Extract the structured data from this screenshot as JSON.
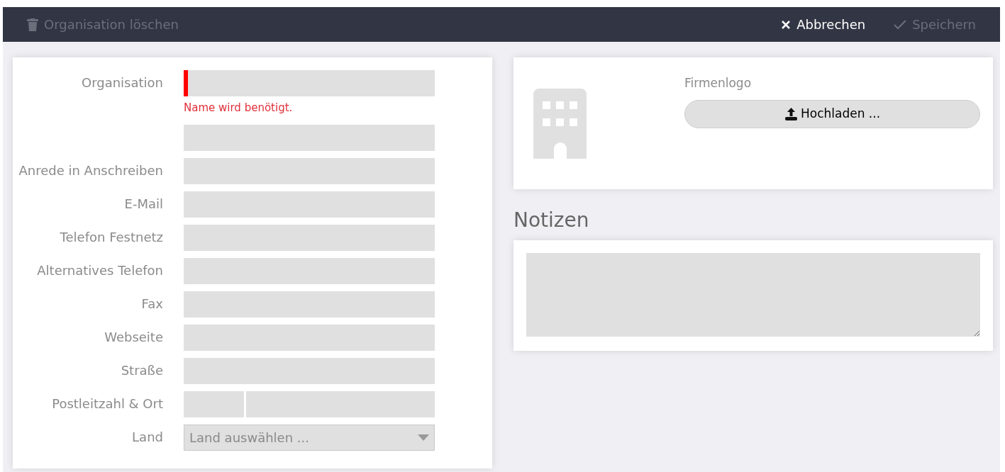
{
  "toolbar": {
    "left": [
      {
        "kind": "delete",
        "label": "Organisation löschen",
        "disabled": true
      }
    ],
    "right": [
      {
        "kind": "cancel",
        "label": "Abbrechen",
        "disabled": false
      },
      {
        "kind": "save",
        "label": "Speichern",
        "disabled": true
      }
    ]
  },
  "form": {
    "fields": [
      {
        "kind": "text",
        "label": "Organisation",
        "invalid": true,
        "error": "Name wird benötigt."
      },
      {
        "kind": "text",
        "invalid": false
      },
      {
        "kind": "text",
        "label": "Anrede in Anschreiben",
        "invalid": false
      },
      {
        "kind": "text",
        "label": "E-Mail",
        "invalid": false
      },
      {
        "kind": "text",
        "label": "Telefon Festnetz",
        "invalid": false
      },
      {
        "kind": "text",
        "label": "Alternatives Telefon",
        "invalid": false
      },
      {
        "kind": "text",
        "label": "Fax",
        "invalid": false
      },
      {
        "kind": "text",
        "label": "Webseite",
        "invalid": false
      },
      {
        "kind": "text",
        "label": "Straße",
        "invalid": false
      },
      {
        "kind": "split",
        "label": "Postleitzahl & Ort",
        "invalid": false
      },
      {
        "kind": "select",
        "label": "Land",
        "placeholder": "Land auswählen ...",
        "invalid": false
      }
    ]
  },
  "logo": {
    "label": "Firmenlogo",
    "upload_button": "Hochladen ..."
  },
  "notes": {
    "title": "Notizen"
  }
}
